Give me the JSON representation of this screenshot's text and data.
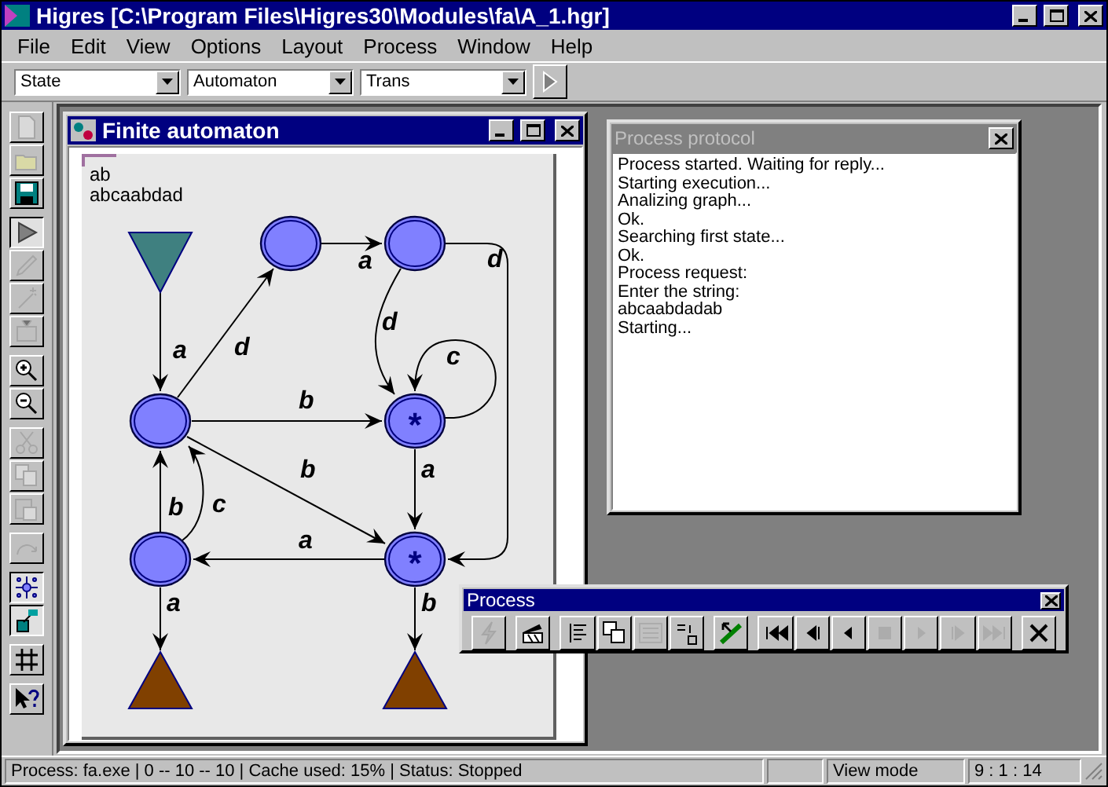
{
  "window": {
    "title": "Higres [C:\\Program Files\\Higres30\\Modules\\fa\\A_1.hgr]"
  },
  "menu": [
    "File",
    "Edit",
    "View",
    "Options",
    "Layout",
    "Process",
    "Window",
    "Help"
  ],
  "toolbar": {
    "combos": [
      {
        "value": "State"
      },
      {
        "value": "Automaton"
      },
      {
        "value": "Trans"
      }
    ]
  },
  "left_toolbar": [
    {
      "kind": "new",
      "disabled": true,
      "pressed": false
    },
    {
      "kind": "open",
      "disabled": true,
      "pressed": false
    },
    {
      "kind": "save",
      "disabled": false,
      "pressed": false
    },
    {
      "kind": "run",
      "disabled": false,
      "pressed": true
    },
    {
      "kind": "pen",
      "disabled": true,
      "pressed": false
    },
    {
      "kind": "wand",
      "disabled": true,
      "pressed": false
    },
    {
      "kind": "tv",
      "disabled": true,
      "pressed": false
    },
    {
      "kind": "zoom-in",
      "disabled": false,
      "pressed": false
    },
    {
      "kind": "zoom-out",
      "disabled": false,
      "pressed": false
    },
    {
      "kind": "cut",
      "disabled": true,
      "pressed": false
    },
    {
      "kind": "copy",
      "disabled": true,
      "pressed": false
    },
    {
      "kind": "paste",
      "disabled": true,
      "pressed": false
    },
    {
      "kind": "undo",
      "disabled": true,
      "pressed": false
    },
    {
      "kind": "layout",
      "disabled": false,
      "pressed": true
    },
    {
      "kind": "tool",
      "disabled": false,
      "pressed": true
    },
    {
      "kind": "grid",
      "disabled": false,
      "pressed": false
    },
    {
      "kind": "help",
      "disabled": false,
      "pressed": false
    }
  ],
  "automaton_window": {
    "title": "Finite automaton",
    "texts": [
      "ab",
      "abcaabdad"
    ],
    "graph": {
      "nodes": [
        {
          "kind": "start"
        },
        {
          "kind": "state"
        },
        {
          "kind": "state"
        },
        {
          "kind": "state"
        },
        {
          "kind": "state",
          "label": "*"
        },
        {
          "kind": "state"
        },
        {
          "kind": "state",
          "label": "*"
        },
        {
          "kind": "end"
        },
        {
          "kind": "end"
        }
      ],
      "edges": [
        {
          "label": "a"
        },
        {
          "label": "d"
        },
        {
          "label": "a"
        },
        {
          "label": "d"
        },
        {
          "label": "d"
        },
        {
          "label": "c"
        },
        {
          "label": "b"
        },
        {
          "label": "b"
        },
        {
          "label": "a"
        },
        {
          "label": "a"
        },
        {
          "label": "b"
        },
        {
          "label": "c"
        },
        {
          "label": "a"
        },
        {
          "label": "b"
        }
      ]
    }
  },
  "protocol_window": {
    "title": "Process protocol",
    "active": false,
    "lines": [
      "Process started. Waiting for reply...",
      "Starting execution...",
      "Analizing graph...",
      "Ok.",
      "Searching first state...",
      "Ok.",
      "Process request:",
      "Enter the string:",
      "abcaabdadab",
      "Starting..."
    ]
  },
  "process_toolbar": {
    "title": "Process",
    "buttons": [
      {
        "kind": "lightning",
        "disabled": true
      },
      {
        "kind": "clapper",
        "disabled": false
      },
      {
        "kind": "text",
        "disabled": false
      },
      {
        "kind": "windows",
        "disabled": false
      },
      {
        "kind": "list",
        "disabled": true
      },
      {
        "kind": "step-list",
        "disabled": false
      },
      {
        "kind": "pick",
        "disabled": false
      },
      {
        "kind": "first",
        "disabled": false
      },
      {
        "kind": "step-back",
        "disabled": false
      },
      {
        "kind": "back",
        "disabled": false
      },
      {
        "kind": "stop",
        "disabled": true
      },
      {
        "kind": "play",
        "disabled": true
      },
      {
        "kind": "step-forward",
        "disabled": true
      },
      {
        "kind": "last",
        "disabled": true
      },
      {
        "kind": "close",
        "disabled": false
      }
    ]
  },
  "status_bar": {
    "text": "Process: fa.exe | 0 -- 10 -- 10 | Cache used: 15% | Status: Stopped",
    "mode": "View mode",
    "position": "9 : 1 : 14"
  }
}
